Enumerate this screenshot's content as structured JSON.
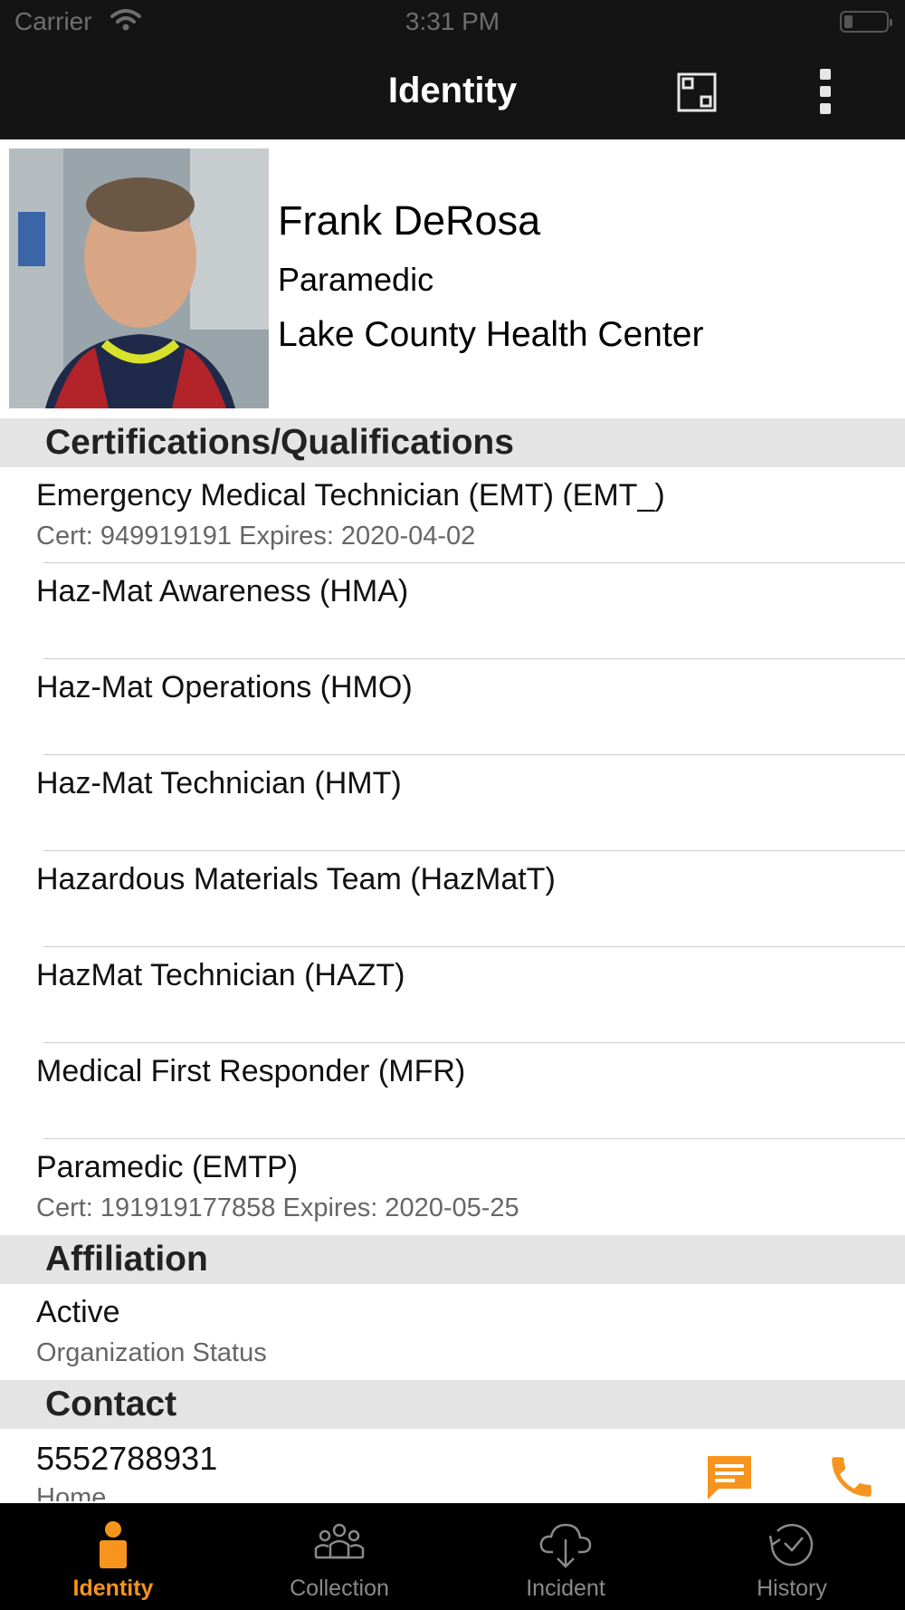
{
  "status_bar": {
    "carrier": "Carrier",
    "time": "3:31 PM"
  },
  "nav": {
    "title": "Identity",
    "scan_icon": "qr-scan-icon",
    "more_icon": "more-vertical-icon"
  },
  "profile": {
    "name": "Frank DeRosa",
    "role": "Paramedic",
    "organization": "Lake County Health Center"
  },
  "certifications": {
    "header": "Certifications/Qualifications",
    "items": [
      {
        "title": "Emergency Medical Technician (EMT) (EMT_)",
        "detail": "Cert: 949919191 Expires: 2020-04-02"
      },
      {
        "title": "Haz-Mat Awareness (HMA)",
        "detail": ""
      },
      {
        "title": "Haz-Mat Operations (HMO)",
        "detail": ""
      },
      {
        "title": "Haz-Mat Technician (HMT)",
        "detail": ""
      },
      {
        "title": "Hazardous Materials Team (HazMatT)",
        "detail": ""
      },
      {
        "title": "HazMat Technician (HAZT)",
        "detail": ""
      },
      {
        "title": "Medical First Responder (MFR)",
        "detail": ""
      },
      {
        "title": "Paramedic (EMTP)",
        "detail": "Cert: 191919177858 Expires: 2020-05-25"
      }
    ]
  },
  "affiliation": {
    "header": "Affiliation",
    "status": "Active",
    "status_label": "Organization Status"
  },
  "contact": {
    "header": "Contact",
    "phone": "5552788931",
    "phone_type": "Home",
    "message_icon": "message-icon",
    "call_icon": "phone-icon"
  },
  "tabs": [
    {
      "label": "Identity",
      "icon": "person-icon",
      "active": true
    },
    {
      "label": "Collection",
      "icon": "group-icon",
      "active": false
    },
    {
      "label": "Incident",
      "icon": "cloud-download-icon",
      "active": false
    },
    {
      "label": "History",
      "icon": "history-icon",
      "active": false
    }
  ],
  "colors": {
    "accent": "#f7941d",
    "bar_background": "#141414",
    "section_background": "#e4e4e4"
  }
}
